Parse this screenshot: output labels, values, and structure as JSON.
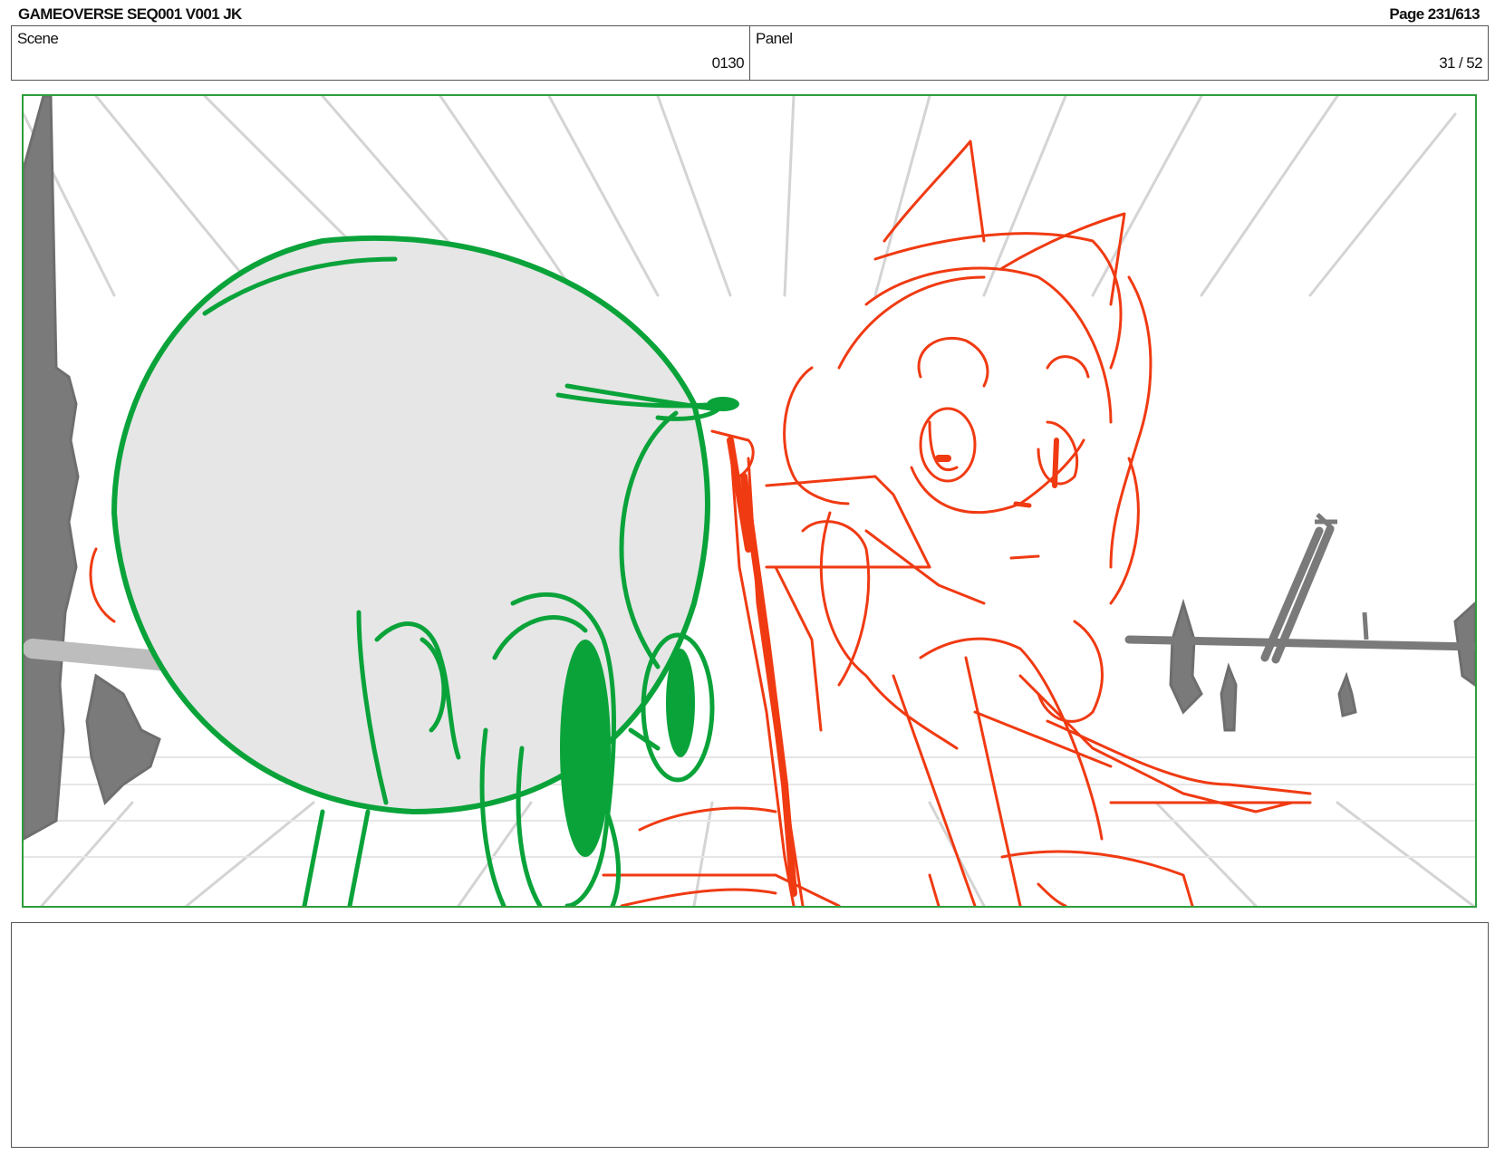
{
  "header": {
    "title": "GAMEOVERSE SEQ001 V001 JK",
    "page": "Page 231/613"
  },
  "scene": {
    "label": "Scene",
    "value": "0130"
  },
  "panel": {
    "label": "Panel",
    "value": "31 / 52"
  },
  "colors": {
    "frame_border": "#2e9e3c",
    "green_character": "#0aa33a",
    "red_character": "#f03a12",
    "background_props": "#7a7a7a",
    "perspective_lines": "#d2d2d2",
    "helmet_fill": "#e6e6e6"
  },
  "notes": {
    "text": ""
  }
}
